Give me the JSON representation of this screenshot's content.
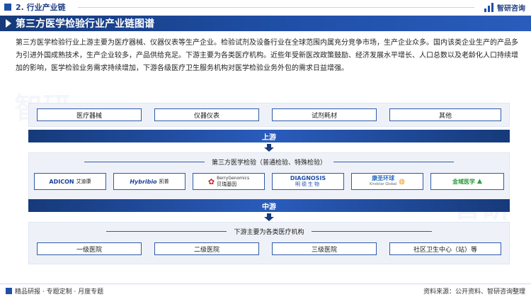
{
  "section": {
    "label": "2. 行业产业链"
  },
  "brand": {
    "name": "智研咨询"
  },
  "title": "第三方医学检验行业产业链图谱",
  "intro": "第三方医学检验行业上游主要为医疗器械、仪器仪表等生产企业。检验试剂及设备行业在全球范围内属充分竞争市场，生产企业众多。国内该类企业生产的产品多为引进外国成熟技术，生产企业较多，产品供给充足。下游主要为各类医疗机构。近些年受新医改政策鼓励、经济发展水平增长、人口总数以及老龄化人口持续增加的影响，医学检验业务需求持续增加，下游各级医疗卫生服务机构对医学检验业务外包的需求日益增强。",
  "upstream": {
    "items": [
      "医疗器械",
      "仪器仪表",
      "试剂耗材",
      "其他"
    ],
    "label": "上游"
  },
  "midstream": {
    "heading": "第三方医学检验（普通检验、特殊检验）",
    "companies": [
      {
        "name": "ADICON",
        "sub": "艾迪康",
        "color": "#1a3f9a"
      },
      {
        "name": "Hybribio",
        "sub": "凯普",
        "color": "#1a3f9a"
      },
      {
        "name": "BerryGenomics",
        "sub": "贝瑞基因",
        "color": "#c0242b"
      },
      {
        "name": "DIAGNOSIS",
        "sub": "明德生物",
        "color": "#1f4fa8"
      },
      {
        "name": "康圣环球",
        "sub": "Kindstar Global",
        "color": "#2a6fc1"
      },
      {
        "name": "金域医学",
        "sub": "",
        "color": "#2f9c3e"
      }
    ],
    "label": "中游"
  },
  "downstream": {
    "heading": "下游主要为各类医疗机构",
    "items": [
      "一级医院",
      "二级医院",
      "三级医院",
      "社区卫生中心（站）等"
    ]
  },
  "footer": {
    "left": "精品研报 · 专题定制 · 月度专题",
    "right": "资料来源：公开资料、智研咨询整理"
  }
}
